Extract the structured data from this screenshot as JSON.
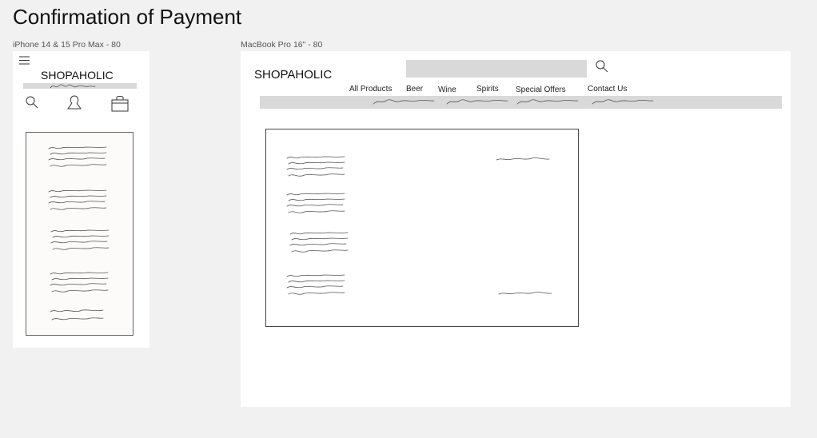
{
  "page": {
    "title": "Confirmation of Payment"
  },
  "mobile": {
    "frame_label": "iPhone 14 & 15 Pro Max - 80",
    "brand": "SHOPAHOLIC",
    "icons": [
      "menu-icon",
      "search-icon",
      "user-icon",
      "shopping-bag-icon"
    ]
  },
  "desktop": {
    "frame_label": "MacBook Pro 16\" - 80",
    "brand": "SHOPAHOLIC",
    "search": {
      "value": ""
    },
    "nav": [
      "All Products",
      "Beer",
      "Wine",
      "Spirits",
      "Special Offers",
      "Contact Us"
    ],
    "icons": [
      "search-icon"
    ]
  },
  "colors": {
    "background": "#f1f1f1",
    "frame": "#ffffff",
    "placeholder_bar": "#d9d9d9",
    "mobile_card": "#fcfbf9"
  }
}
